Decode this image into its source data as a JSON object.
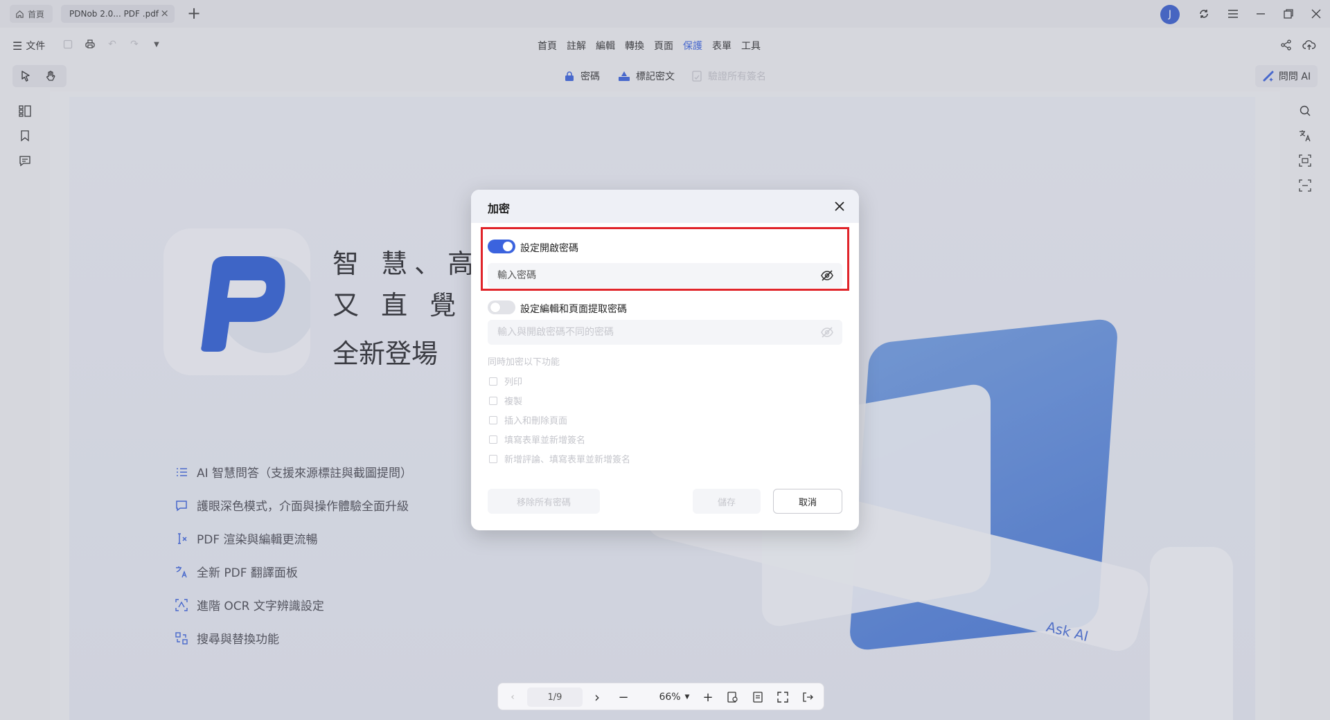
{
  "tabs": {
    "home_label": "首頁",
    "file_label": "PDNob 2.0... PDF .pdf",
    "close_symbol": "×",
    "add_symbol": "+"
  },
  "account": {
    "avatar_letter": "J"
  },
  "menubar": {
    "file_label": "文件",
    "items": [
      "首頁",
      "註解",
      "編輯",
      "轉換",
      "頁面",
      "保護",
      "表單",
      "工具"
    ],
    "active_item": "保護"
  },
  "protect_toolbar": {
    "password_label": "密碼",
    "redact_label": "標記密文",
    "verify_label": "驗證所有簽名",
    "ask_ai_label": "問問 AI"
  },
  "document": {
    "headline_line1": "智 慧、高 效",
    "headline_line2": "又 直 覺 操",
    "subhead": "全新登場",
    "features": [
      "AI 智慧問答（支援來源標註與截圖提問）",
      "護眼深色模式，介面與操作體驗全面升級",
      "PDF 渲染與編輯更流暢",
      "全新 PDF 翻譯面板",
      "進階 OCR 文字辨識設定",
      "搜尋與替換功能"
    ],
    "deco_ask_ai": "Ask AI"
  },
  "dialog": {
    "title": "加密",
    "open_password": {
      "label": "設定開啟密碼",
      "enabled": true,
      "placeholder": "輸入密碼",
      "value": ""
    },
    "edit_password": {
      "label": "設定編輯和頁面提取密碼",
      "enabled": false,
      "placeholder": "輸入與開啟密碼不同的密碼",
      "value": ""
    },
    "restrictions_title": "同時加密以下功能",
    "restrictions": [
      "列印",
      "複製",
      "插入和刪除頁面",
      "填寫表單並新增簽名",
      "新增評論、填寫表單並新增簽名"
    ],
    "remove_all_label": "移除所有密碼",
    "save_label": "儲存",
    "cancel_label": "取消",
    "highlight_color": "#e0242a",
    "accent_color": "#3b63de"
  },
  "pagebar": {
    "page_indicator": "1/9",
    "zoom_level": "66%"
  }
}
